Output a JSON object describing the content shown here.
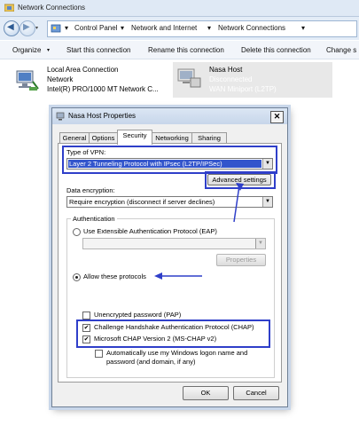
{
  "window": {
    "title": "Network Connections"
  },
  "address": {
    "crumbs": [
      "Control Panel",
      "Network and Internet",
      "Network Connections"
    ]
  },
  "toolbar": {
    "organize": "Organize",
    "start": "Start this connection",
    "rename": "Rename this connection",
    "delete": "Delete this connection",
    "change": "Change s"
  },
  "connections": [
    {
      "name": "Local Area Connection",
      "line2": "Network",
      "line3": "Intel(R) PRO/1000 MT Network C..."
    },
    {
      "name": "Nasa Host",
      "line2": "Disconnected",
      "line3": "WAN Miniport (L2TP)"
    }
  ],
  "dialog": {
    "title": "Nasa Host Properties",
    "tabs": [
      "General",
      "Options",
      "Security",
      "Networking",
      "Sharing"
    ],
    "active_tab": "Security",
    "vpn_label": "Type of VPN:",
    "vpn_value": "Layer 2 Tunneling Protocol with IPsec (L2TP/IPSec)",
    "advanced": "Advanced settings",
    "enc_label": "Data encryption:",
    "enc_value": "Require encryption (disconnect if server declines)",
    "auth_label": "Authentication",
    "eap_label": "Use Extensible Authentication Protocol (EAP)",
    "eap_value": "",
    "properties": "Properties",
    "allow_label": "Allow these protocols",
    "pap": "Unencrypted password (PAP)",
    "chap": "Challenge Handshake Authentication Protocol (CHAP)",
    "mschap": "Microsoft CHAP Version 2 (MS-CHAP v2)",
    "auto_line1": "Automatically use my Windows logon name and",
    "auto_line2": "password (and domain, if any)",
    "ok": "OK",
    "cancel": "Cancel"
  },
  "colors": {
    "highlight": "#2f3fc9",
    "selection": "#3355cc"
  }
}
